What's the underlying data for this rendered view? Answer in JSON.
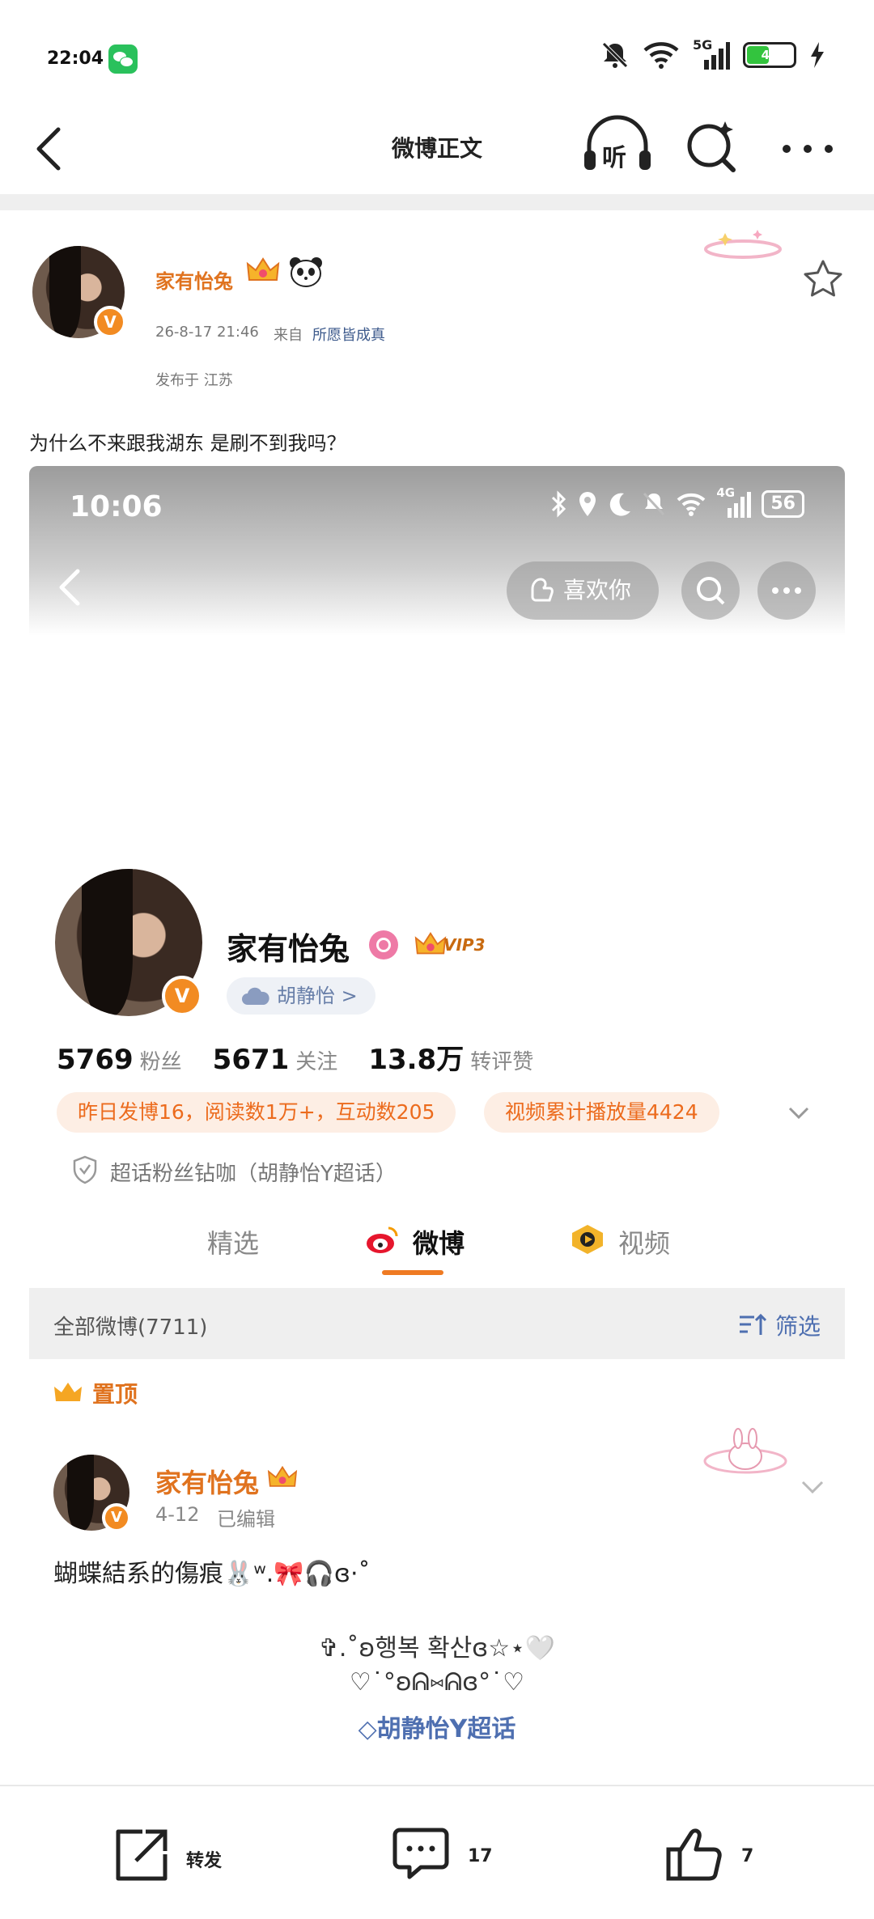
{
  "status_bar": {
    "time": "22:04",
    "network": "5G",
    "battery_level": "45",
    "icons": [
      "wechat-icon",
      "mute-icon",
      "wifi-icon",
      "signal-icon",
      "battery-icon",
      "charging-icon"
    ]
  },
  "nav": {
    "title": "微博正文",
    "listen_label": "听"
  },
  "post": {
    "author": "家有怡兔",
    "time": "26-8-17 21:46",
    "source_prefix": "来自",
    "source": "所愿皆成真",
    "location": "发布于 江苏",
    "text": "为什么不来跟我湖东 是刷不到我吗？",
    "verified_badge": "V"
  },
  "embed": {
    "time": "10:06",
    "network": "4G",
    "battery": "56",
    "like_label": "喜欢你",
    "profile": {
      "name": "家有怡兔",
      "vip": "VIP3",
      "supertopic": "胡静怡 >",
      "stats": [
        {
          "num": "5769",
          "label": "粉丝"
        },
        {
          "num": "5671",
          "label": "关注"
        },
        {
          "num": "13.8万",
          "label": "转评赞"
        }
      ],
      "pill1": "昨日发博16，阅读数1万+，互动数205",
      "pill2": "视频累计播放量4424",
      "fanclub": "超话粉丝钻咖（胡静怡Y超话）"
    },
    "tabs": [
      "精选",
      "微博",
      "视频"
    ],
    "active_tab": "微博",
    "all_posts": "全部微博(7711)",
    "filter": "筛选",
    "pinned": "置顶",
    "pinned_post": {
      "author": "家有怡兔",
      "date": "4-12",
      "edited": "已编辑",
      "text": "蝴蝶結系的傷痕🐰ʷ.🎀🎧ɞ·˚",
      "line1": "✞.˚ʚ행복 확산ɞ☆⋆🤍",
      "line2": "♡˙°ʚᕱ⑅ᕱɞ°˙♡",
      "topic": "胡静怡Y超话"
    }
  },
  "bottom_bar": {
    "repost_label": "转发",
    "comment_count": "17",
    "like_count": "7"
  },
  "colors": {
    "accent_orange": "#e0731f",
    "link_blue": "#3d5a8c",
    "pill_bg": "#fdeee4"
  }
}
